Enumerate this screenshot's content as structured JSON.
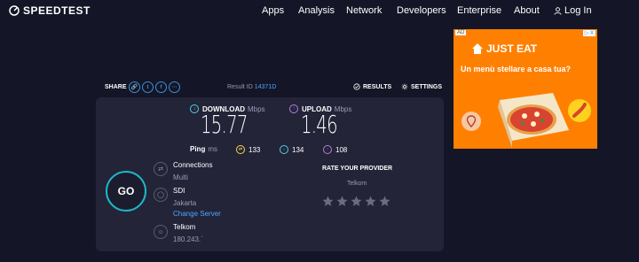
{
  "brand": {
    "name": "SPEEDTEST"
  },
  "nav": {
    "items": [
      {
        "label": "Apps"
      },
      {
        "label": "Analysis"
      },
      {
        "label": "Network"
      },
      {
        "label": "Developers"
      },
      {
        "label": "Enterprise"
      },
      {
        "label": "About"
      }
    ],
    "login": "Log In"
  },
  "share": {
    "label": "SHARE",
    "icons": [
      "link-icon",
      "twitter-icon",
      "facebook-icon",
      "more-icon"
    ],
    "result_id_label": "Result ID",
    "result_id_value": "14371D",
    "results_label": "RESULTS",
    "settings_label": "SETTINGS"
  },
  "download": {
    "label": "DOWNLOAD",
    "unit": "Mbps",
    "value": "15.77"
  },
  "upload": {
    "label": "UPLOAD",
    "unit": "Mbps",
    "value": "1.46"
  },
  "ping": {
    "label": "Ping",
    "unit": "ms",
    "idle": "133",
    "download": "134",
    "upload": "108"
  },
  "go_label": "GO",
  "connections": {
    "title": "Connections",
    "value": "Multi"
  },
  "server": {
    "title": "SDI",
    "location": "Jakarta",
    "change_label": "Change Server"
  },
  "provider": {
    "name": "Telkom",
    "ip": "180.243.`"
  },
  "rating": {
    "title": "RATE YOUR PROVIDER",
    "provider": "Telkom",
    "stars": 5
  },
  "ad": {
    "badge": "AD",
    "close": "▷ X",
    "brand": "JUST EAT",
    "headline": "Un menù stellare a casa tua?"
  },
  "colors": {
    "background": "#141526",
    "card": "#232438",
    "download": "#4dd0e1",
    "upload": "#b57edc",
    "go_ring": "#1fb6c7",
    "link": "#4da6ff",
    "ad": "#ff8000"
  }
}
